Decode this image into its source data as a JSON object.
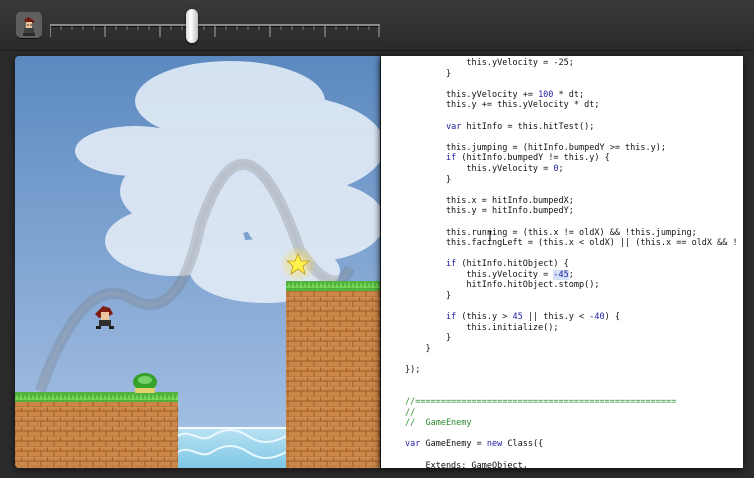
{
  "timeline": {
    "value": 0.43
  },
  "code": {
    "lines": [
      [
        {
          "t": "            this.yVelocity = -25;"
        }
      ],
      [
        {
          "t": "        }"
        }
      ],
      [],
      [
        {
          "t": "        this.yVelocity += "
        },
        {
          "t": "100",
          "c": "number"
        },
        {
          "t": " * dt;"
        }
      ],
      [
        {
          "t": "        this.y += this.yVelocity * dt;"
        }
      ],
      [],
      [
        {
          "t": "        "
        },
        {
          "t": "var",
          "c": "keyword"
        },
        {
          "t": " hitInfo = this.hitTest();"
        }
      ],
      [],
      [
        {
          "t": "        this.jumping = (hitInfo.bumpedY >= this.y);"
        }
      ],
      [
        {
          "t": "        "
        },
        {
          "t": "if",
          "c": "keyword"
        },
        {
          "t": " (hitInfo.bumpedY != this.y) {"
        }
      ],
      [
        {
          "t": "            this.yVelocity = "
        },
        {
          "t": "0",
          "c": "number"
        },
        {
          "t": ";"
        }
      ],
      [
        {
          "t": "        }"
        }
      ],
      [],
      [
        {
          "t": "        this.x = hitInfo.bumpedX;"
        }
      ],
      [
        {
          "t": "        this.y = hitInfo.bumpedY;"
        }
      ],
      [],
      [
        {
          "t": "        this.running = (this.x != oldX) && !this.jumping;"
        }
      ],
      [
        {
          "t": "        this.facingLeft = (this.x < oldX) || (this.x == oldX && !"
        }
      ],
      [],
      [
        {
          "t": "        "
        },
        {
          "t": "if",
          "c": "keyword"
        },
        {
          "t": " (hitInfo.hitObject) {"
        }
      ],
      [
        {
          "t": "            this.yVelocity = "
        },
        {
          "t": "-45",
          "c": "selected"
        },
        {
          "t": ";"
        }
      ],
      [
        {
          "t": "            hitInfo.hitObject.stomp();"
        }
      ],
      [
        {
          "t": "        }"
        }
      ],
      [],
      [
        {
          "t": "        "
        },
        {
          "t": "if",
          "c": "keyword"
        },
        {
          "t": " (this.y > "
        },
        {
          "t": "45",
          "c": "number"
        },
        {
          "t": " || this.y < "
        },
        {
          "t": "-40",
          "c": "number"
        },
        {
          "t": ") {"
        }
      ],
      [
        {
          "t": "            this.initialize();"
        }
      ],
      [
        {
          "t": "        }"
        }
      ],
      [
        {
          "t": "    }"
        }
      ],
      [],
      [
        {
          "t": "});"
        }
      ],
      [],
      [],
      [
        {
          "t": "//===================================================",
          "c": "comment"
        }
      ],
      [
        {
          "t": "//",
          "c": "comment"
        }
      ],
      [
        {
          "t": "//  GameEnemy",
          "c": "comment"
        }
      ],
      [],
      [
        {
          "t": "var",
          "c": "keyword"
        },
        {
          "t": " GameEnemy = "
        },
        {
          "t": "new",
          "c": "keyword"
        },
        {
          "t": " Class({"
        }
      ],
      [],
      [
        {
          "t": "    Extends: GameObject,"
        }
      ]
    ]
  },
  "colors": {
    "comment": "#2b8d2b",
    "keyword": "#1c1ca3",
    "selection": "#d5dff6"
  },
  "icons": {
    "avatar": "player-avatar-icon",
    "timeline_handle": "timeline-handle",
    "star": "star-powerup-icon",
    "player": "player-character-icon",
    "enemy": "turtle-enemy-icon"
  }
}
